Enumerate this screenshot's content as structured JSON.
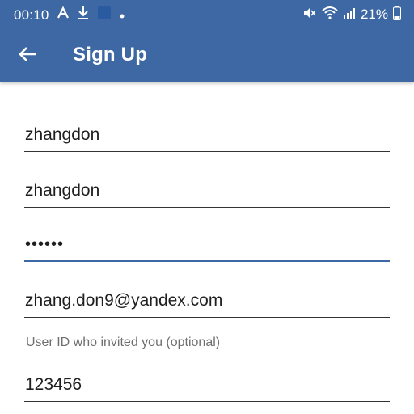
{
  "status_bar": {
    "time": "00:10",
    "battery": "21%",
    "icons_left": [
      "a-app-icon",
      "download-icon",
      "app-square-icon",
      "dot-icon"
    ],
    "icons_right": [
      "mute-icon",
      "wifi-icon",
      "signal-icon",
      "battery-icon"
    ]
  },
  "app_bar": {
    "title": "Sign Up",
    "back_icon": "arrow-left-icon",
    "color": "#3e68a3"
  },
  "form": {
    "username": "zhangdon",
    "display_name": "zhangdon",
    "password": "••••••",
    "email": "zhang.don9@yandex.com",
    "invite_label": "User ID who invited you (optional)",
    "invite_id": "123456"
  }
}
